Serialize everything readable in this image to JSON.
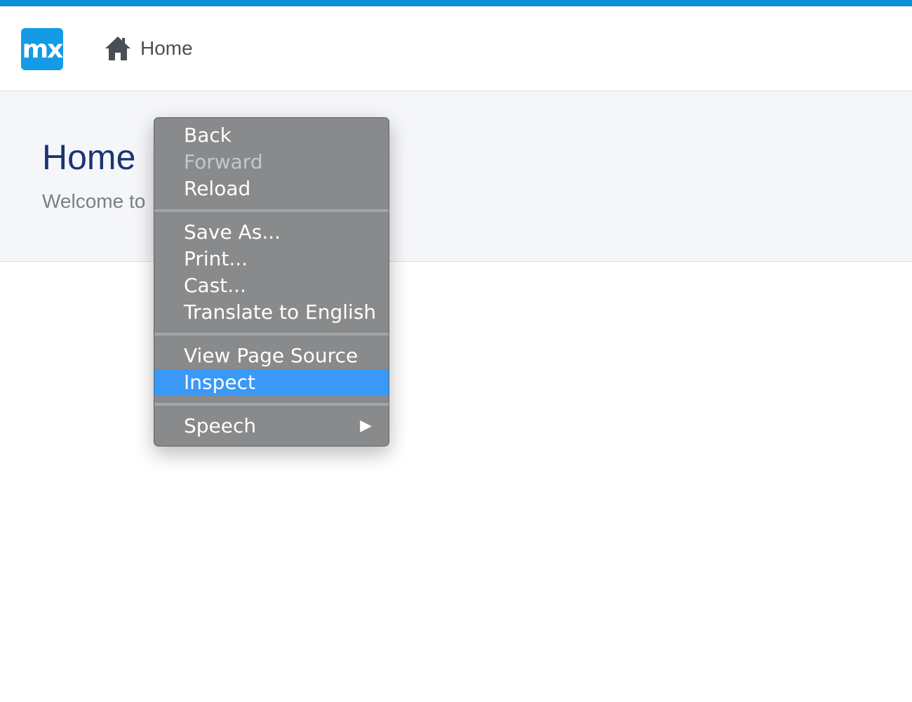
{
  "app": {
    "logo_text": "mx",
    "accent_color": "#0a8fdb",
    "nav": {
      "home_label": "Home",
      "home_icon": "home-icon"
    }
  },
  "page": {
    "title": "Home",
    "subtitle": "Welcome to"
  },
  "context_menu": {
    "highlight_color": "#3a98f7",
    "groups": [
      [
        {
          "label": "Back",
          "enabled": true
        },
        {
          "label": "Forward",
          "enabled": false
        },
        {
          "label": "Reload",
          "enabled": true
        }
      ],
      [
        {
          "label": "Save As...",
          "enabled": true
        },
        {
          "label": "Print...",
          "enabled": true
        },
        {
          "label": "Cast...",
          "enabled": true
        },
        {
          "label": "Translate to English",
          "enabled": true
        }
      ],
      [
        {
          "label": "View Page Source",
          "enabled": true
        },
        {
          "label": "Inspect",
          "enabled": true,
          "highlighted": true
        }
      ],
      [
        {
          "label": "Speech",
          "enabled": true,
          "submenu": true,
          "submenu_icon": "triangle-right-icon"
        }
      ]
    ]
  }
}
